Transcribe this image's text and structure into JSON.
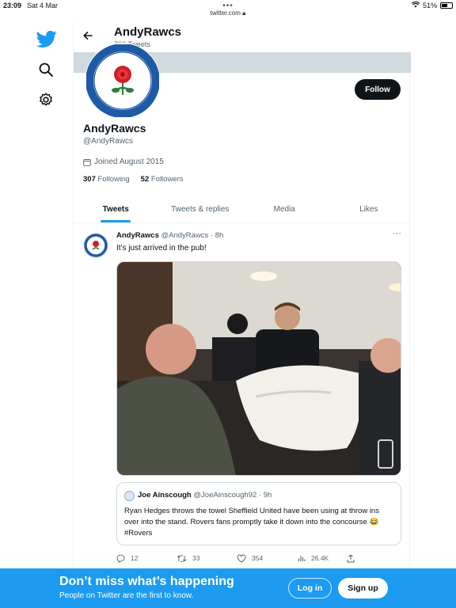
{
  "status_bar": {
    "time": "23:09",
    "date": "Sat 4 Mar",
    "battery": "51%"
  },
  "browser": {
    "url": "twitter.com"
  },
  "nav": {
    "icons": [
      "twitter-logo-icon",
      "search-icon",
      "settings-icon"
    ]
  },
  "header": {
    "name": "AndyRawcs",
    "tweet_count": "700 Tweets",
    "back_icon": "arrow-left-icon"
  },
  "profile": {
    "name": "AndyRawcs",
    "handle": "@AndyRawcs",
    "joined": "Joined August 2015",
    "following_count": "307",
    "following_label": "Following",
    "followers_count": "52",
    "followers_label": "Followers",
    "follow_button": "Follow",
    "avatar_badge_text": [
      "BLACKBURN ROVERS F.C.",
      "ARTE ET LABORE"
    ]
  },
  "tabs": [
    "Tweets",
    "Tweets & replies",
    "Media",
    "Likes"
  ],
  "tweet": {
    "author": "AndyRawcs",
    "handle": "@AndyRawcs",
    "time": "· 8h",
    "text": "It's just arrived in the pub!",
    "more": "···",
    "quote": {
      "author": "Joe Ainscough",
      "handle": "@JoeAinscough92",
      "time": "· 9h",
      "text": "Ryan Hedges throws the towel Sheffield United have been using at throw ins over into the stand. Rovers fans promptly take it down into the concourse 😂 #Rovers"
    },
    "actions": {
      "replies": "12",
      "retweets": "33",
      "likes": "354",
      "views": "26.4K"
    }
  },
  "bottom_banner": {
    "title": "Don’t miss what’s happening",
    "subtitle": "People on Twitter are the first to know.",
    "login": "Log in",
    "signup": "Sign up"
  },
  "colors": {
    "accent": "#1d9bf0",
    "text": "#0f1419",
    "muted": "#536471"
  }
}
